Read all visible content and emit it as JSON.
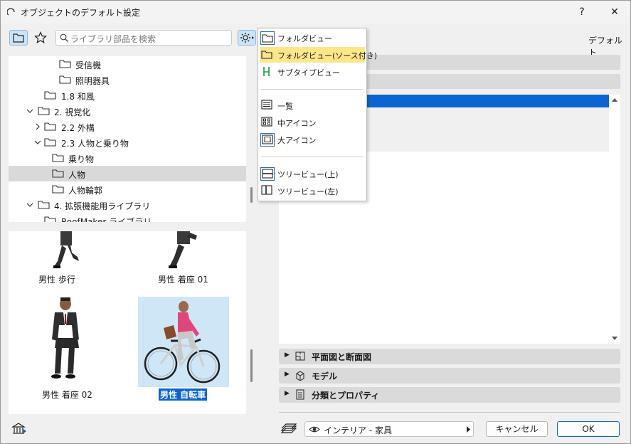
{
  "window": {
    "title": "オブジェクトのデフォルト設定",
    "help_label": "?",
    "close_label": "✕"
  },
  "search": {
    "placeholder": "ライブラリ部品を検索"
  },
  "tree": {
    "items": [
      {
        "label": "受信機"
      },
      {
        "label": "照明器具"
      },
      {
        "label": "1.8 和風"
      },
      {
        "label": "2. 視覚化"
      },
      {
        "label": "2.2 外構"
      },
      {
        "label": "2.3 人物と乗り物"
      },
      {
        "label": "乗り物"
      },
      {
        "label": "人物"
      },
      {
        "label": "人物輪郭"
      },
      {
        "label": "4. 拡張機能用ライブラリ"
      },
      {
        "label": "RoofMaker ライブラリ"
      }
    ]
  },
  "thumbnails": [
    {
      "label": "男性 歩行"
    },
    {
      "label": "男性 着座 01"
    },
    {
      "label": "男性 着座 02"
    },
    {
      "label": "男性 自転車"
    }
  ],
  "right": {
    "default_label": "デフォルト",
    "sections": [
      {
        "label": "平面図と断面図"
      },
      {
        "label": "モデル"
      },
      {
        "label": "分類とプロパティ"
      }
    ]
  },
  "footer": {
    "layer_value": "インテリア - 家具",
    "cancel_label": "キャンセル",
    "ok_label": "OK"
  },
  "menu": {
    "items": [
      {
        "label": "フォルダビュー"
      },
      {
        "label": "フォルダビュー(ソース付き)"
      },
      {
        "label": "サブタイプビュー"
      },
      {
        "label": "一覧"
      },
      {
        "label": "中アイコン"
      },
      {
        "label": "大アイコン"
      },
      {
        "label": "ツリービュー(上)"
      },
      {
        "label": "ツリービュー(左)"
      }
    ]
  },
  "colors": {
    "selection_blue": "#0a64d2",
    "menu_highlight": "#fce68a",
    "thumb_selected_bg": "#cfe6f7"
  }
}
